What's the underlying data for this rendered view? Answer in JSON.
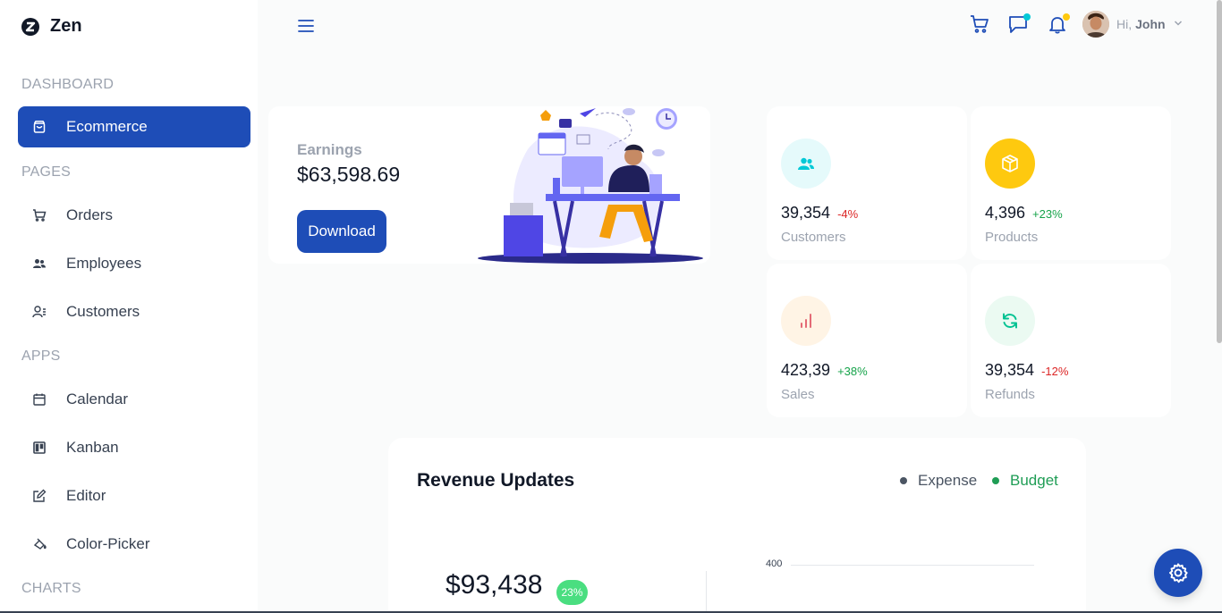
{
  "app": {
    "brand": "Zen"
  },
  "sidebar": {
    "sections": [
      {
        "title": "DASHBOARD"
      },
      {
        "title": "PAGES"
      },
      {
        "title": "APPS"
      },
      {
        "title": "CHARTS"
      }
    ],
    "items": [
      {
        "label": "Ecommerce",
        "icon": "shopping-bag-icon",
        "active": true
      },
      {
        "label": "Orders",
        "icon": "cart-icon"
      },
      {
        "label": "Employees",
        "icon": "employees-icon"
      },
      {
        "label": "Customers",
        "icon": "customers-icon"
      },
      {
        "label": "Calendar",
        "icon": "calendar-icon"
      },
      {
        "label": "Kanban",
        "icon": "kanban-icon"
      },
      {
        "label": "Editor",
        "icon": "edit-icon"
      },
      {
        "label": "Color-Picker",
        "icon": "color-picker-icon"
      }
    ]
  },
  "header": {
    "greeting": "Hi,",
    "user_name": "John",
    "icons": [
      "menu-icon",
      "cart-icon",
      "chat-icon",
      "bell-icon",
      "chevron-down-icon"
    ]
  },
  "earnings": {
    "label": "Earnings",
    "value": "$63,598.69",
    "button": "Download"
  },
  "stats": [
    {
      "value": "39,354",
      "change": "-4%",
      "label": "Customers",
      "icon": "customers-icon",
      "color": "#03c9d7",
      "bg": "#e5fafb",
      "trend": "down"
    },
    {
      "value": "4,396",
      "change": "+23%",
      "label": "Products",
      "icon": "box-icon",
      "color": "#ffffff",
      "bg": "#fec90f",
      "trend": "up"
    },
    {
      "value": "423,39",
      "change": "+38%",
      "label": "Sales",
      "icon": "bar-chart-icon",
      "color": "#e46a76",
      "bg": "#fff4e5",
      "trend": "up"
    },
    {
      "value": "39,354",
      "change": "-12%",
      "label": "Refunds",
      "icon": "refresh-icon",
      "color": "#00c292",
      "bg": "#ebfaf2",
      "trend": "down"
    }
  ],
  "revenue": {
    "title": "Revenue Updates",
    "legend": [
      {
        "label": "Expense",
        "color": "#4b5563"
      },
      {
        "label": "Budget",
        "color": "#1f9d55"
      }
    ],
    "amount": "$93,438",
    "badge": "23%",
    "y_tick": "400"
  },
  "colors": {
    "accent": "#1e4db7",
    "negative": "#dc2626",
    "positive": "#16a34a"
  }
}
